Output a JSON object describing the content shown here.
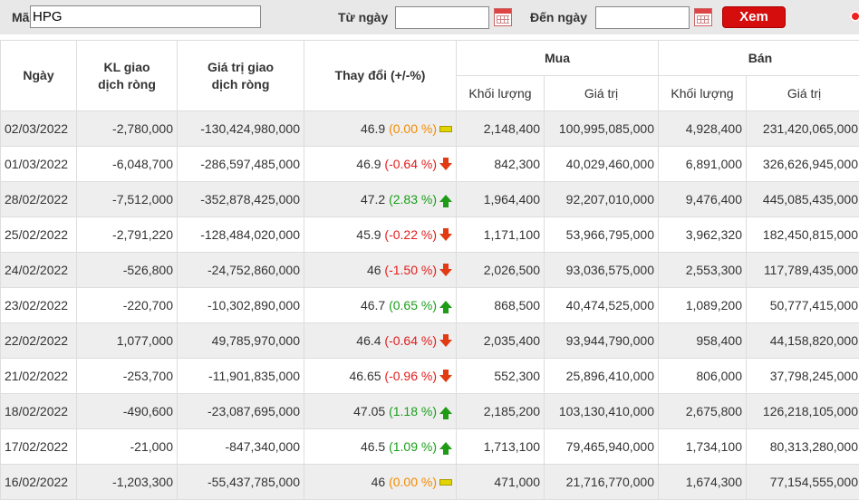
{
  "filter": {
    "ma_label": "Mã",
    "ma_value": "HPG",
    "tu_ngay_label": "Từ ngày",
    "tu_ngay_value": "",
    "den_ngay_label": "Đến ngày",
    "den_ngay_value": "",
    "xem_label": "Xem",
    "calendar_icon": "calendar-icon",
    "settings_icon": "gear-icon"
  },
  "table": {
    "headers": {
      "ngay": "Ngày",
      "kl_line1": "KL giao",
      "kl_line2": "dịch ròng",
      "gt_line1": "Giá trị giao",
      "gt_line2": "dịch ròng",
      "thay_doi": "Thay đổi (+/-%)",
      "mua": "Mua",
      "ban": "Bán",
      "khoi_luong": "Khối lượng",
      "gia_tri": "Giá trị"
    },
    "colors": {
      "up": "#1a9e1a",
      "down": "#e21d1d",
      "ref": "#f28c00"
    },
    "rows": [
      {
        "date": "02/03/2022",
        "kl": "-2,780,000",
        "gt": "-130,424,980,000",
        "price": "46.9",
        "pct": "(0.00 %)",
        "dir": "ref",
        "mua_kl": "2,148,400",
        "mua_gt": "100,995,085,000",
        "ban_kl": "4,928,400",
        "ban_gt": "231,420,065,000"
      },
      {
        "date": "01/03/2022",
        "kl": "-6,048,700",
        "gt": "-286,597,485,000",
        "price": "46.9",
        "pct": "(-0.64 %)",
        "dir": "down",
        "mua_kl": "842,300",
        "mua_gt": "40,029,460,000",
        "ban_kl": "6,891,000",
        "ban_gt": "326,626,945,000"
      },
      {
        "date": "28/02/2022",
        "kl": "-7,512,000",
        "gt": "-352,878,425,000",
        "price": "47.2",
        "pct": "(2.83 %)",
        "dir": "up",
        "mua_kl": "1,964,400",
        "mua_gt": "92,207,010,000",
        "ban_kl": "9,476,400",
        "ban_gt": "445,085,435,000"
      },
      {
        "date": "25/02/2022",
        "kl": "-2,791,220",
        "gt": "-128,484,020,000",
        "price": "45.9",
        "pct": "(-0.22 %)",
        "dir": "down",
        "mua_kl": "1,171,100",
        "mua_gt": "53,966,795,000",
        "ban_kl": "3,962,320",
        "ban_gt": "182,450,815,000"
      },
      {
        "date": "24/02/2022",
        "kl": "-526,800",
        "gt": "-24,752,860,000",
        "price": "46",
        "pct": "(-1.50 %)",
        "dir": "down",
        "mua_kl": "2,026,500",
        "mua_gt": "93,036,575,000",
        "ban_kl": "2,553,300",
        "ban_gt": "117,789,435,000"
      },
      {
        "date": "23/02/2022",
        "kl": "-220,700",
        "gt": "-10,302,890,000",
        "price": "46.7",
        "pct": "(0.65 %)",
        "dir": "up",
        "mua_kl": "868,500",
        "mua_gt": "40,474,525,000",
        "ban_kl": "1,089,200",
        "ban_gt": "50,777,415,000"
      },
      {
        "date": "22/02/2022",
        "kl": "1,077,000",
        "gt": "49,785,970,000",
        "price": "46.4",
        "pct": "(-0.64 %)",
        "dir": "down",
        "mua_kl": "2,035,400",
        "mua_gt": "93,944,790,000",
        "ban_kl": "958,400",
        "ban_gt": "44,158,820,000"
      },
      {
        "date": "21/02/2022",
        "kl": "-253,700",
        "gt": "-11,901,835,000",
        "price": "46.65",
        "pct": "(-0.96 %)",
        "dir": "down",
        "mua_kl": "552,300",
        "mua_gt": "25,896,410,000",
        "ban_kl": "806,000",
        "ban_gt": "37,798,245,000"
      },
      {
        "date": "18/02/2022",
        "kl": "-490,600",
        "gt": "-23,087,695,000",
        "price": "47.05",
        "pct": "(1.18 %)",
        "dir": "up",
        "mua_kl": "2,185,200",
        "mua_gt": "103,130,410,000",
        "ban_kl": "2,675,800",
        "ban_gt": "126,218,105,000"
      },
      {
        "date": "17/02/2022",
        "kl": "-21,000",
        "gt": "-847,340,000",
        "price": "46.5",
        "pct": "(1.09 %)",
        "dir": "up",
        "mua_kl": "1,713,100",
        "mua_gt": "79,465,940,000",
        "ban_kl": "1,734,100",
        "ban_gt": "80,313,280,000"
      },
      {
        "date": "16/02/2022",
        "kl": "-1,203,300",
        "gt": "-55,437,785,000",
        "price": "46",
        "pct": "(0.00 %)",
        "dir": "ref",
        "mua_kl": "471,000",
        "mua_gt": "21,716,770,000",
        "ban_kl": "1,674,300",
        "ban_gt": "77,154,555,000"
      }
    ]
  }
}
